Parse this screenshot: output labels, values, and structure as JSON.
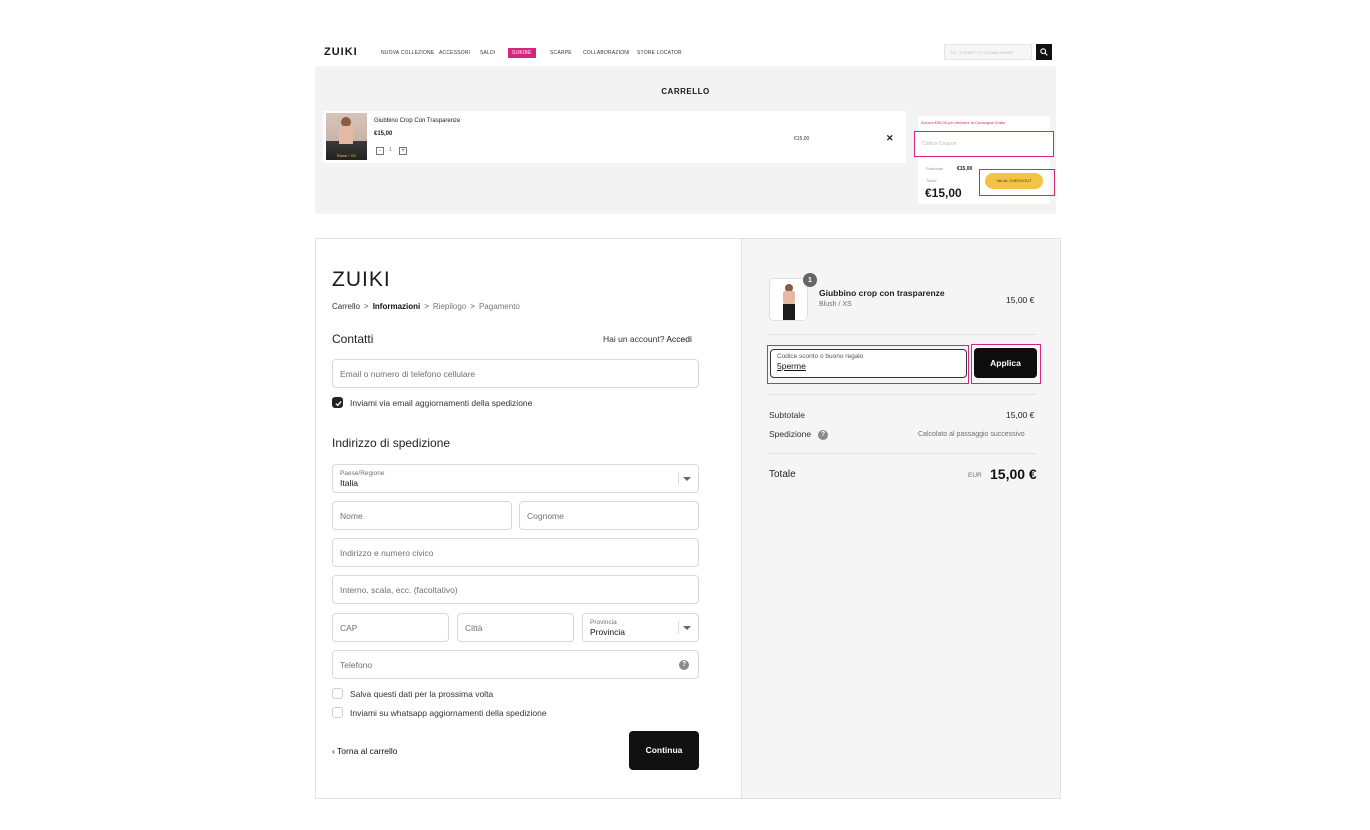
{
  "store": {
    "nav": {
      "logo": "ZUIKI",
      "items": [
        "NUOVA COLLEZIONE",
        "ACCESSORI",
        "SALDI",
        "SUKIBE",
        "SCARPE",
        "COLLABORAZIONI",
        "STORE LOCATOR"
      ],
      "highlighted_index": 3,
      "search_placeholder": "ES. \"T-SHIRT\" O \"GONNA VERDE\""
    },
    "cart": {
      "title": "CARRELLO",
      "item": {
        "name": "Giubbino Crop Con Trasparenze",
        "price": "€15,00",
        "variant_tag": "Blush / XS",
        "qty": "1",
        "qty_minus": "-",
        "qty_plus": "+",
        "line_price": "€15,00",
        "remove": "✕"
      },
      "promo_message": "Ancora €35,00 per ottenere la Consegna Gratis",
      "coupon_placeholder": "Codice Coupon",
      "subtotal_label": "Subtotale",
      "subtotal_value": "€15,00",
      "total_label": "Totale",
      "total_value": "€15,00",
      "checkout_label": "VAI AL CHECKOUT"
    }
  },
  "checkout": {
    "logo": "ZUIKI",
    "breadcrumb": [
      "Carrello",
      "Informazioni",
      "Riepilogo",
      "Pagamento"
    ],
    "breadcrumb_sep": ">",
    "contact": {
      "title": "Contatti",
      "account_prompt": "Hai un account?",
      "login_link": "Accedi",
      "email_placeholder": "Email o numero di telefono cellulare",
      "newsletter_label": "Inviami via email aggiornamenti della spedizione",
      "newsletter_checked": true
    },
    "shipping": {
      "title": "Indirizzo di spedizione",
      "country_label": "Paese/Regione",
      "country_value": "Italia",
      "first_name_placeholder": "Nome",
      "last_name_placeholder": "Cognome",
      "address_placeholder": "Indirizzo e numero civico",
      "apartment_placeholder": "Interno, scala, ecc. (facoltativo)",
      "zip_placeholder": "CAP",
      "city_placeholder": "Città",
      "province_label": "Provincia",
      "province_value": "Provincia",
      "phone_placeholder": "Telefono",
      "phone_help": "?",
      "save_info_label": "Salva questi dati per la prossima volta",
      "whatsapp_label": "Inviami su whatsapp aggiornamenti della spedizione"
    },
    "back_label": "‹ Torna al carrello",
    "continue_label": "Continua"
  },
  "summary": {
    "item": {
      "qty_badge": "1",
      "name": "Giubbino crop con trasparenze",
      "variant": "Blush / XS",
      "price": "15,00 €"
    },
    "discount": {
      "label": "Codice sconto o buono regalo",
      "value": "5perme",
      "apply_label": "Applica"
    },
    "subtotal_label": "Subtotale",
    "subtotal_value": "15,00 €",
    "shipping_label": "Spedizione",
    "shipping_help": "?",
    "shipping_value": "Calcolato al passaggio successivo",
    "total_label": "Totale",
    "currency": "EUR",
    "total_value": "15,00 €"
  },
  "colors": {
    "accent_pink": "#d6247f",
    "checkout_yellow": "#f6c245",
    "button_black": "#0d0d0d"
  }
}
